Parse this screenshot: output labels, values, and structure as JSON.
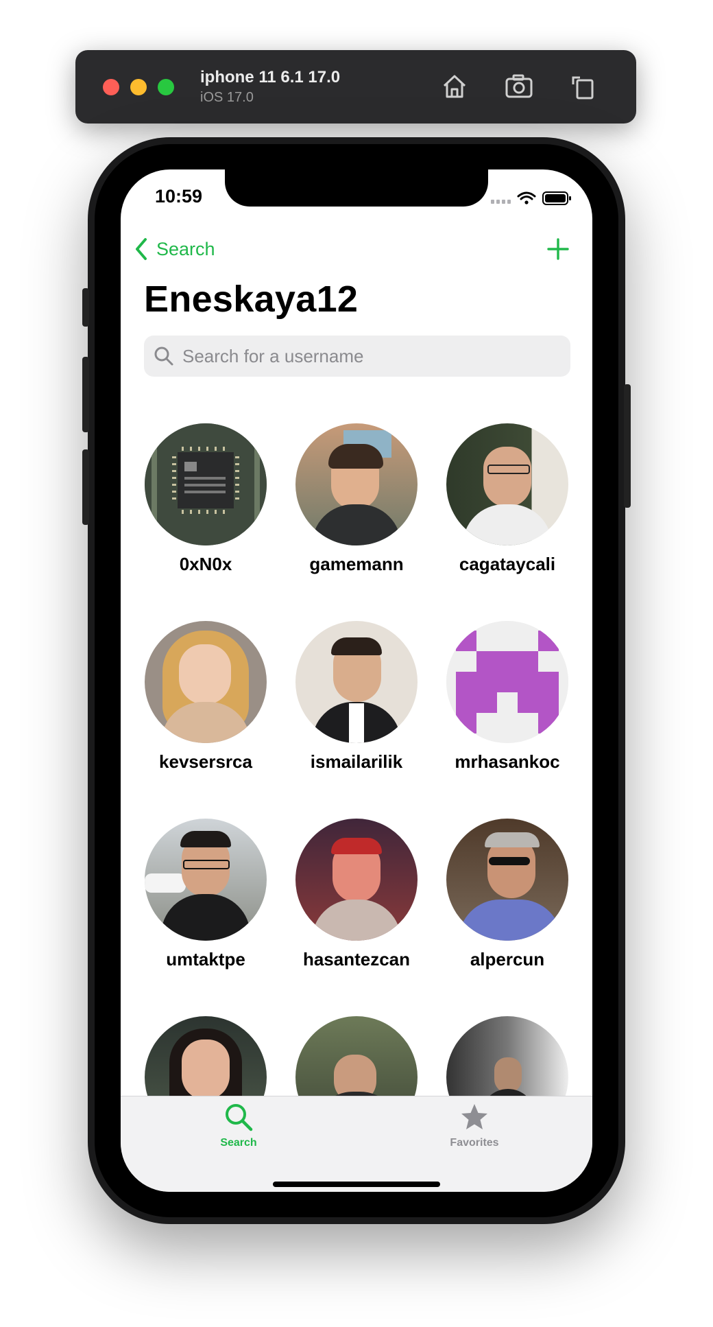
{
  "simulator": {
    "device_name": "iphone 11 6.1 17.0",
    "os_version": "iOS 17.0",
    "home_icon": "home-icon",
    "screenshot_icon": "camera-icon",
    "rotate_icon": "rotate-icon"
  },
  "status_bar": {
    "time": "10:59"
  },
  "nav": {
    "back_label": "Search",
    "add_icon": "plus-icon",
    "title": "Eneskaya12"
  },
  "search": {
    "placeholder": "Search for a username",
    "value": ""
  },
  "users": [
    {
      "username": "0xN0x"
    },
    {
      "username": "gamemann"
    },
    {
      "username": "cagataycali"
    },
    {
      "username": "kevsersrca"
    },
    {
      "username": "ismailarilik"
    },
    {
      "username": "mrhasankoc"
    },
    {
      "username": "umtaktpe"
    },
    {
      "username": "hasantezcan"
    },
    {
      "username": "alpercun"
    },
    {
      "username": ""
    },
    {
      "username": ""
    },
    {
      "username": ""
    }
  ],
  "tabs": [
    {
      "label": "Search",
      "icon": "search-icon",
      "active": true
    },
    {
      "label": "Favorites",
      "icon": "star-icon",
      "active": false
    }
  ],
  "colors": {
    "accent": "#20b84a",
    "inactive": "#8e8e93"
  }
}
